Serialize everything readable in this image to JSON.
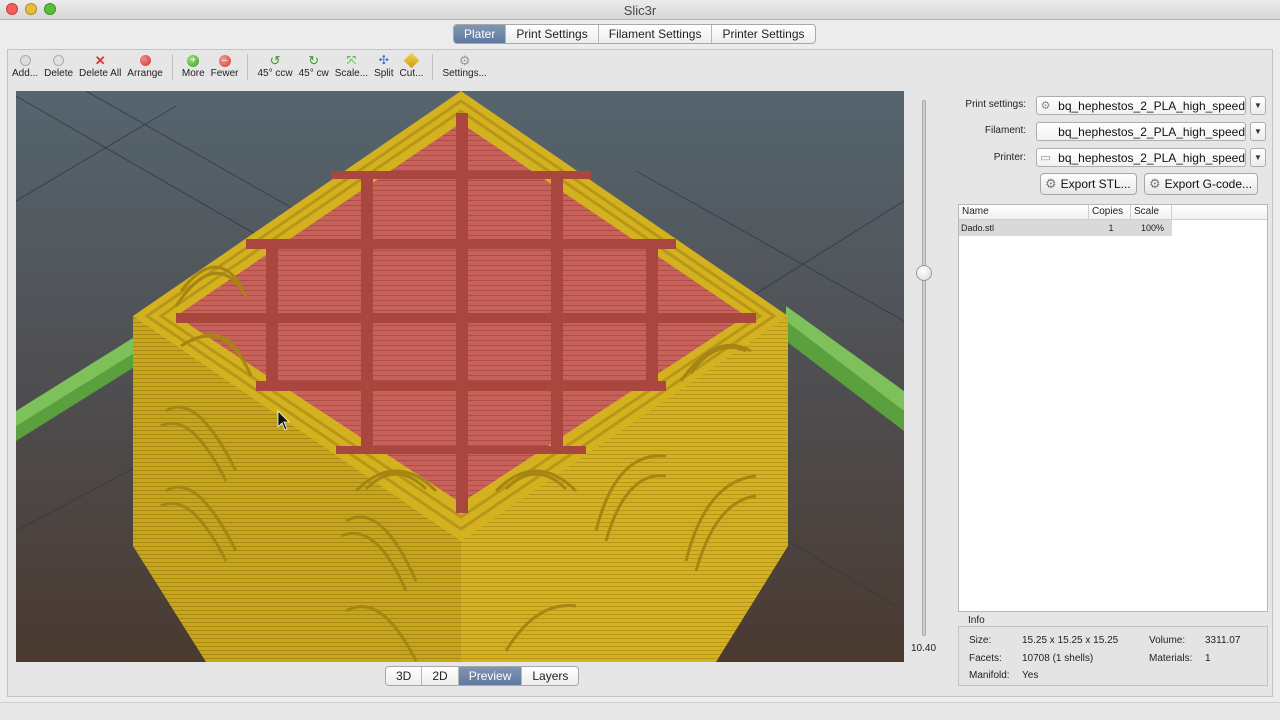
{
  "window": {
    "title": "Slic3r"
  },
  "tabs": [
    "Plater",
    "Print Settings",
    "Filament Settings",
    "Printer Settings"
  ],
  "toolbar": {
    "add": "Add...",
    "delete": "Delete",
    "delete_all": "Delete All",
    "arrange": "Arrange",
    "more": "More",
    "fewer": "Fewer",
    "rotate_ccw": "45° ccw",
    "rotate_cw": "45° cw",
    "scale": "Scale...",
    "split": "Split",
    "cut": "Cut...",
    "settings": "Settings..."
  },
  "view_buttons": [
    "3D",
    "2D",
    "Preview",
    "Layers"
  ],
  "active_view": "Preview",
  "layer_slider": {
    "value": "10.40"
  },
  "settings": {
    "print_label": "Print settings:",
    "print_value": "bq_hephestos_2_PLA_high_speed",
    "filament_label": "Filament:",
    "filament_value": "bq_hephestos_2_PLA_high_speed",
    "printer_label": "Printer:",
    "printer_value": "bq_hephestos_2_PLA_high_speed"
  },
  "export": {
    "stl": "Export STL...",
    "gcode": "Export G-code..."
  },
  "object_list": {
    "columns": [
      "Name",
      "Copies",
      "Scale"
    ],
    "rows": [
      {
        "name": "Dado.stl",
        "copies": "1",
        "scale": "100%"
      }
    ]
  },
  "info": {
    "title": "Info",
    "size_label": "Size:",
    "size_value": "15.25 x 15.25 x 15.25",
    "volume_label": "Volume:",
    "volume_value": "3311.07",
    "facets_label": "Facets:",
    "facets_value": "10708 (1 shells)",
    "materials_label": "Materials:",
    "materials_value": "1",
    "manifold_label": "Manifold:",
    "manifold_value": "Yes"
  },
  "colors": {
    "perimeter": "#d4b21f",
    "infill": "#c9615b",
    "skirt": "#7ec05a",
    "background_top": "#56656f",
    "background_bottom": "#4a3a30",
    "active_tab": "#6f88ac"
  }
}
